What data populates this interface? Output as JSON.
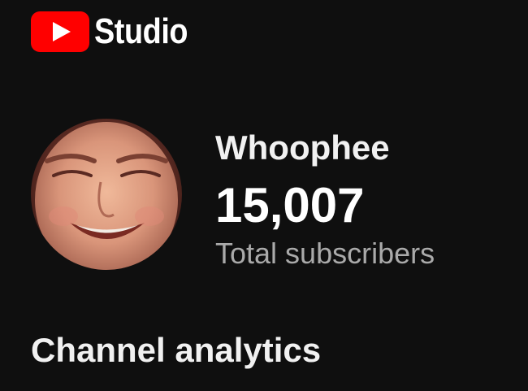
{
  "app": {
    "brand_text": "Studio",
    "logo_icon": "youtube-play-icon",
    "brand_color": "#ff0000"
  },
  "channel": {
    "name": "Whoophee",
    "subscriber_count": "15,007",
    "subscriber_label": "Total subscribers",
    "avatar_icon": "channel-avatar"
  },
  "main": {
    "section_title": "Channel analytics"
  }
}
